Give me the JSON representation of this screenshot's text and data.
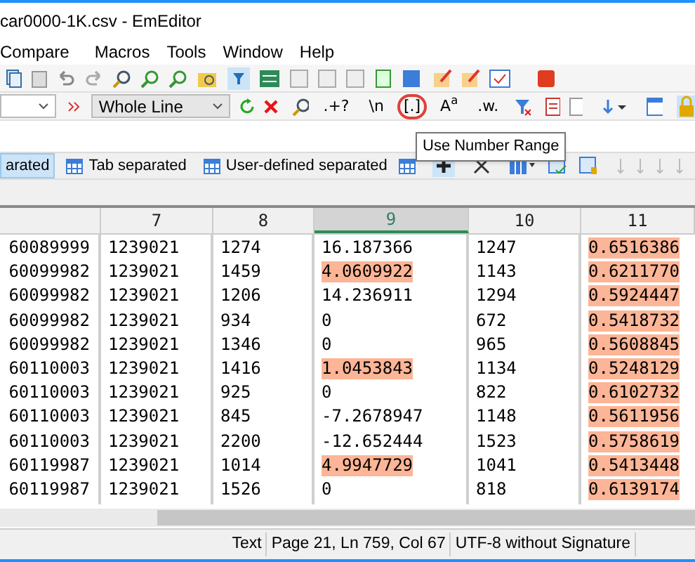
{
  "window": {
    "title": "car0000-1K.csv - EmEditor"
  },
  "menu": [
    "Compare",
    "Macros",
    "Tools",
    "Window",
    "Help"
  ],
  "find_toolbar": {
    "scope": "Whole Line",
    "buttons": [
      {
        "kind": "text",
        "label": ".+?",
        "circled": false
      },
      {
        "kind": "text",
        "label": "\\n",
        "circled": false
      },
      {
        "kind": "text",
        "label": "[.]",
        "circled": true
      },
      {
        "kind": "text",
        "label": "A$^{a}$",
        "circled": false
      },
      {
        "kind": "text",
        "label": ".w.",
        "circled": false
      }
    ]
  },
  "tooltip": "Use Number Range",
  "csv_tabs": [
    {
      "label": "arated",
      "selected": true
    },
    {
      "label": "Tab separated",
      "selected": false
    },
    {
      "label": "User-defined separated",
      "selected": false
    }
  ],
  "table": {
    "columns": [
      {
        "selected": false
      },
      {
        "label": "7",
        "selected": false
      },
      {
        "label": "8",
        "selected": false
      },
      {
        "label": "9",
        "selected": true
      },
      {
        "label": "10",
        "selected": false
      },
      {
        "label": "11",
        "selected": false
      }
    ],
    "rows": [
      {
        "cells": [
          "60089999",
          "1239021",
          "1274",
          "16.187366",
          "1247",
          "0.6516386"
        ],
        "highlighted": [
          false,
          false,
          false,
          false,
          false,
          true
        ]
      },
      {
        "cells": [
          "60099982",
          "1239021",
          "1459",
          "4.0609922",
          "1143",
          "0.6211770"
        ],
        "highlighted": [
          false,
          false,
          false,
          true,
          false,
          true
        ]
      },
      {
        "cells": [
          "60099982",
          "1239021",
          "1206",
          "14.236911",
          "1294",
          "0.5924447"
        ],
        "highlighted": [
          false,
          false,
          false,
          false,
          false,
          true
        ]
      },
      {
        "cells": [
          "60099982",
          "1239021",
          "934",
          "0",
          "672",
          "0.5418732"
        ],
        "highlighted": [
          false,
          false,
          false,
          false,
          false,
          true
        ]
      },
      {
        "cells": [
          "60099982",
          "1239021",
          "1346",
          "0",
          "965",
          "0.5608845"
        ],
        "highlighted": [
          false,
          false,
          false,
          false,
          false,
          true
        ]
      },
      {
        "cells": [
          "60110003",
          "1239021",
          "1416",
          "1.0453843",
          "1134",
          "0.5248129"
        ],
        "highlighted": [
          false,
          false,
          false,
          true,
          false,
          true
        ]
      },
      {
        "cells": [
          "60110003",
          "1239021",
          "925",
          "0",
          "822",
          "0.6102732"
        ],
        "highlighted": [
          false,
          false,
          false,
          false,
          false,
          true
        ]
      },
      {
        "cells": [
          "60110003",
          "1239021",
          "845",
          "-7.2678947",
          "1148",
          "0.5611956"
        ],
        "highlighted": [
          false,
          false,
          false,
          false,
          false,
          true
        ]
      },
      {
        "cells": [
          "60110003",
          "1239021",
          "2200",
          "-12.652444",
          "1523",
          "0.5758619"
        ],
        "highlighted": [
          false,
          false,
          false,
          false,
          false,
          true
        ]
      },
      {
        "cells": [
          "60119987",
          "1239021",
          "1014",
          "4.9947729",
          "1041",
          "0.5413448"
        ],
        "highlighted": [
          false,
          false,
          false,
          true,
          false,
          true
        ]
      },
      {
        "cells": [
          "60119987",
          "1239021",
          "1526",
          "0",
          "818",
          "0.6139174"
        ],
        "highlighted": [
          false,
          false,
          false,
          false,
          false,
          true
        ]
      }
    ]
  },
  "status_bar": [
    "Text",
    "Page 21, Ln 759, Col 67",
    "UTF-8 without Signature"
  ]
}
